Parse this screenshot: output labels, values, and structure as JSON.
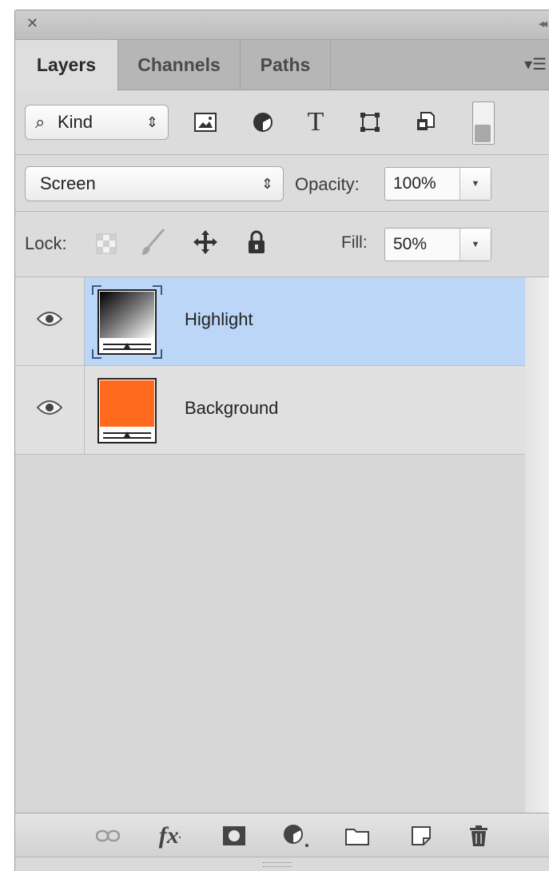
{
  "panel": {
    "tabs": [
      {
        "label": "Layers",
        "active": true
      },
      {
        "label": "Channels",
        "active": false
      },
      {
        "label": "Paths",
        "active": false
      }
    ]
  },
  "filter": {
    "kind_label": "Kind",
    "icons": [
      "pixel-layer-filter-icon",
      "adjustment-layer-filter-icon",
      "type-layer-filter-icon",
      "shape-layer-filter-icon",
      "smart-object-filter-icon"
    ]
  },
  "blend": {
    "mode": "Screen",
    "opacity_label": "Opacity:",
    "opacity_value": "100%"
  },
  "lock": {
    "label": "Lock:",
    "fill_label": "Fill:",
    "fill_value": "50%"
  },
  "layers": [
    {
      "name": "Highlight",
      "selected": true,
      "visible": true,
      "thumb": "gradient"
    },
    {
      "name": "Background",
      "selected": false,
      "visible": true,
      "thumb": "orange",
      "thumb_color": "#ff6a1f"
    }
  ],
  "colors": {
    "selection": "#bcd6f7",
    "panel_bg": "#d6d6d6"
  },
  "toolbar_icons": [
    "link-layers-icon",
    "layer-style-fx-icon",
    "layer-mask-icon",
    "new-adjustment-layer-icon",
    "new-group-icon",
    "new-layer-icon",
    "delete-layer-icon"
  ]
}
